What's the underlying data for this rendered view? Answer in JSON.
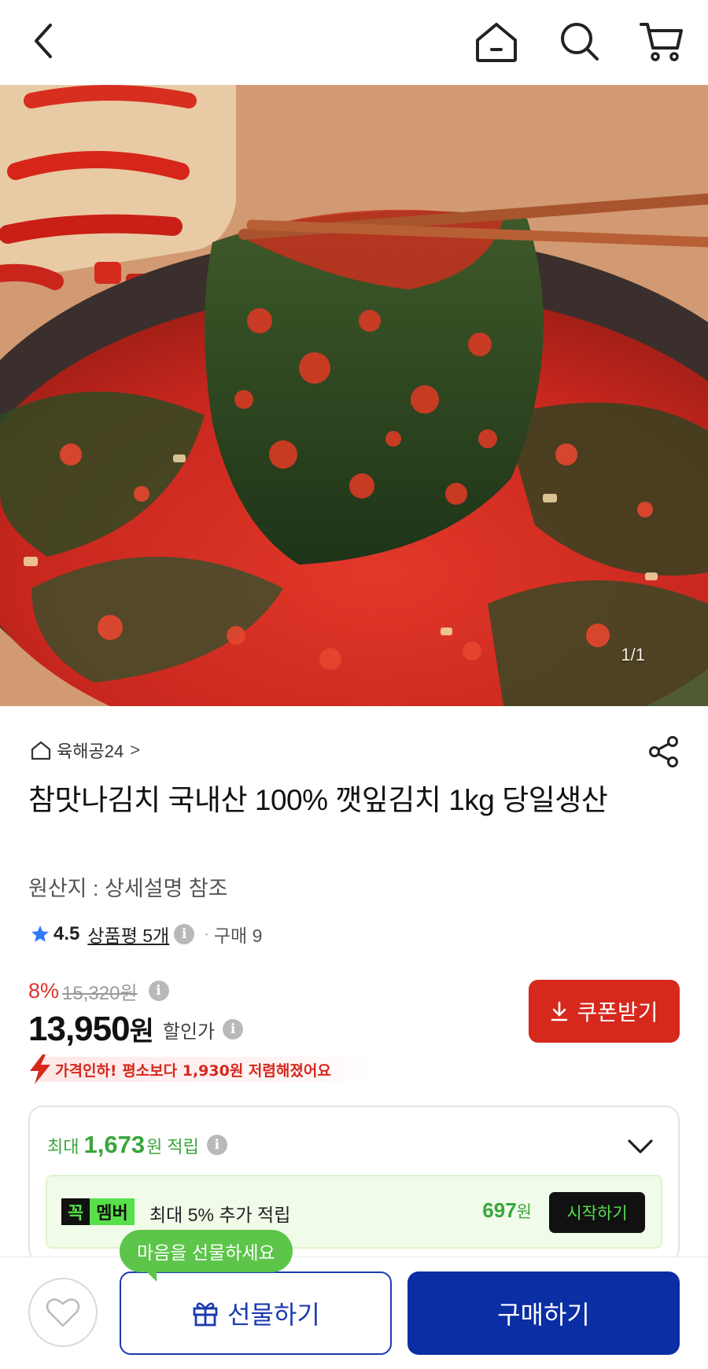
{
  "header": {
    "back_icon": "chevron-left-icon",
    "home_icon": "home-icon",
    "search_icon": "search-icon",
    "cart_icon": "cart-icon"
  },
  "gallery": {
    "counter": "1/1"
  },
  "product": {
    "seller": "육해공24",
    "seller_chevron": ">",
    "title": "참맛나김치 국내산 100% 깻잎김치 1kg 당일생산",
    "origin": "원산지 : 상세설명 참조",
    "rating": "4.5",
    "review_link": "상품평 5개",
    "purchase_separator": "·",
    "purchase_count": "구매 9"
  },
  "price": {
    "discount_rate": "8%",
    "original_price": "15,320원",
    "sale_price_number": "13,950",
    "sale_price_unit": "원",
    "sale_label": "할인가",
    "coupon_button": "쿠폰받기",
    "price_drop_notice": "가격인하! 평소보다 1,930원 저렴해졌어요"
  },
  "reward": {
    "prefix": "최대",
    "amount": "1,673",
    "suffix": "원 적립",
    "member_badge_a": "꼭",
    "member_badge_b": "멤버",
    "member_text": "최대 5% 추가 적립",
    "member_amount": "697",
    "member_amount_unit": "원",
    "start_button": "시작하기"
  },
  "bottom": {
    "tooltip": "마음을 선물하세요",
    "gift_button": "선물하기",
    "buy_button": "구매하기"
  },
  "colors": {
    "sale_red": "#d6281d",
    "reward_green": "#3aa63c",
    "member_green": "#57e04a",
    "primary_blue": "#0a2ea4",
    "star_blue": "#2f7cf6"
  }
}
